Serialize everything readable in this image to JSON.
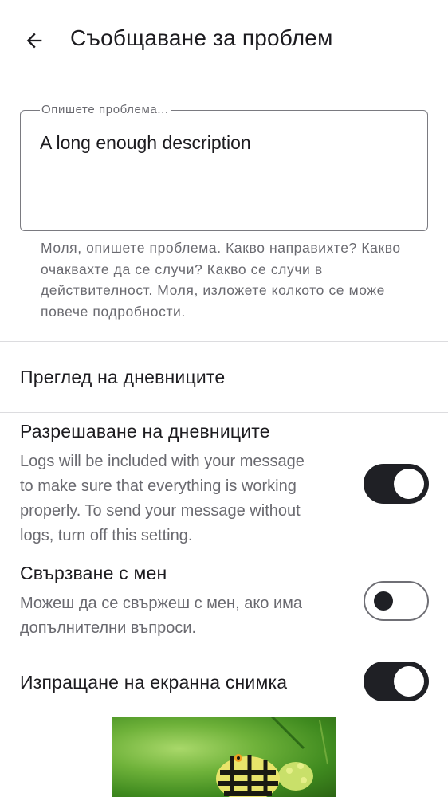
{
  "header": {
    "title": "Съобщаване за проблем"
  },
  "description_field": {
    "label": "Опишете проблема...",
    "value": "A long enough description"
  },
  "helper_text": "Моля, опишете проблема. Какво направихте? Какво очаквахте да се случи? Какво се случи в действителност. Моля, изложете колкото се може повече подробности.",
  "view_logs": {
    "label": "Преглед на дневниците"
  },
  "allow_logs": {
    "title": "Разрешаване на дневниците",
    "description_lines": [
      "Logs will be included with your message",
      "to make sure that everything is working",
      "properly. To send your message without",
      "logs, turn off this setting."
    ],
    "enabled": true
  },
  "contact_me": {
    "title": "Свързване с мен",
    "description_lines": [
      "Можеш да се свържеш с мен, ако има",
      "допълнителни въпроси."
    ],
    "enabled": false
  },
  "send_screenshot": {
    "title": "Изпращане на екранна снимка",
    "enabled": true
  },
  "icons": {
    "back": "arrow-back-icon"
  },
  "colors": {
    "switch_on_track": "#1f2025",
    "switch_off_border": "#6f6f75",
    "secondary_text": "#6a6a70",
    "divider": "#dcdcdf"
  }
}
